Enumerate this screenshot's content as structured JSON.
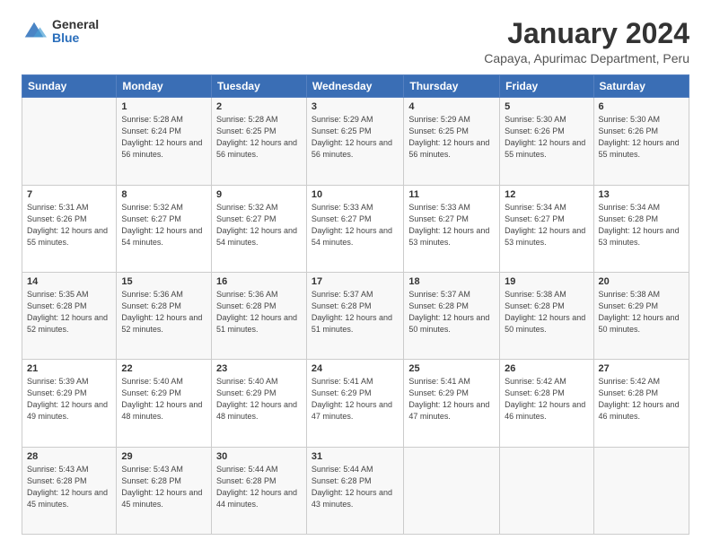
{
  "logo": {
    "general": "General",
    "blue": "Blue"
  },
  "header": {
    "title": "January 2024",
    "subtitle": "Capaya, Apurimac Department, Peru"
  },
  "weekdays": [
    "Sunday",
    "Monday",
    "Tuesday",
    "Wednesday",
    "Thursday",
    "Friday",
    "Saturday"
  ],
  "weeks": [
    [
      {
        "day": "",
        "sunrise": "",
        "sunset": "",
        "daylight": ""
      },
      {
        "day": "1",
        "sunrise": "Sunrise: 5:28 AM",
        "sunset": "Sunset: 6:24 PM",
        "daylight": "Daylight: 12 hours and 56 minutes."
      },
      {
        "day": "2",
        "sunrise": "Sunrise: 5:28 AM",
        "sunset": "Sunset: 6:25 PM",
        "daylight": "Daylight: 12 hours and 56 minutes."
      },
      {
        "day": "3",
        "sunrise": "Sunrise: 5:29 AM",
        "sunset": "Sunset: 6:25 PM",
        "daylight": "Daylight: 12 hours and 56 minutes."
      },
      {
        "day": "4",
        "sunrise": "Sunrise: 5:29 AM",
        "sunset": "Sunset: 6:25 PM",
        "daylight": "Daylight: 12 hours and 56 minutes."
      },
      {
        "day": "5",
        "sunrise": "Sunrise: 5:30 AM",
        "sunset": "Sunset: 6:26 PM",
        "daylight": "Daylight: 12 hours and 55 minutes."
      },
      {
        "day": "6",
        "sunrise": "Sunrise: 5:30 AM",
        "sunset": "Sunset: 6:26 PM",
        "daylight": "Daylight: 12 hours and 55 minutes."
      }
    ],
    [
      {
        "day": "7",
        "sunrise": "Sunrise: 5:31 AM",
        "sunset": "Sunset: 6:26 PM",
        "daylight": "Daylight: 12 hours and 55 minutes."
      },
      {
        "day": "8",
        "sunrise": "Sunrise: 5:32 AM",
        "sunset": "Sunset: 6:27 PM",
        "daylight": "Daylight: 12 hours and 54 minutes."
      },
      {
        "day": "9",
        "sunrise": "Sunrise: 5:32 AM",
        "sunset": "Sunset: 6:27 PM",
        "daylight": "Daylight: 12 hours and 54 minutes."
      },
      {
        "day": "10",
        "sunrise": "Sunrise: 5:33 AM",
        "sunset": "Sunset: 6:27 PM",
        "daylight": "Daylight: 12 hours and 54 minutes."
      },
      {
        "day": "11",
        "sunrise": "Sunrise: 5:33 AM",
        "sunset": "Sunset: 6:27 PM",
        "daylight": "Daylight: 12 hours and 53 minutes."
      },
      {
        "day": "12",
        "sunrise": "Sunrise: 5:34 AM",
        "sunset": "Sunset: 6:27 PM",
        "daylight": "Daylight: 12 hours and 53 minutes."
      },
      {
        "day": "13",
        "sunrise": "Sunrise: 5:34 AM",
        "sunset": "Sunset: 6:28 PM",
        "daylight": "Daylight: 12 hours and 53 minutes."
      }
    ],
    [
      {
        "day": "14",
        "sunrise": "Sunrise: 5:35 AM",
        "sunset": "Sunset: 6:28 PM",
        "daylight": "Daylight: 12 hours and 52 minutes."
      },
      {
        "day": "15",
        "sunrise": "Sunrise: 5:36 AM",
        "sunset": "Sunset: 6:28 PM",
        "daylight": "Daylight: 12 hours and 52 minutes."
      },
      {
        "day": "16",
        "sunrise": "Sunrise: 5:36 AM",
        "sunset": "Sunset: 6:28 PM",
        "daylight": "Daylight: 12 hours and 51 minutes."
      },
      {
        "day": "17",
        "sunrise": "Sunrise: 5:37 AM",
        "sunset": "Sunset: 6:28 PM",
        "daylight": "Daylight: 12 hours and 51 minutes."
      },
      {
        "day": "18",
        "sunrise": "Sunrise: 5:37 AM",
        "sunset": "Sunset: 6:28 PM",
        "daylight": "Daylight: 12 hours and 50 minutes."
      },
      {
        "day": "19",
        "sunrise": "Sunrise: 5:38 AM",
        "sunset": "Sunset: 6:28 PM",
        "daylight": "Daylight: 12 hours and 50 minutes."
      },
      {
        "day": "20",
        "sunrise": "Sunrise: 5:38 AM",
        "sunset": "Sunset: 6:29 PM",
        "daylight": "Daylight: 12 hours and 50 minutes."
      }
    ],
    [
      {
        "day": "21",
        "sunrise": "Sunrise: 5:39 AM",
        "sunset": "Sunset: 6:29 PM",
        "daylight": "Daylight: 12 hours and 49 minutes."
      },
      {
        "day": "22",
        "sunrise": "Sunrise: 5:40 AM",
        "sunset": "Sunset: 6:29 PM",
        "daylight": "Daylight: 12 hours and 48 minutes."
      },
      {
        "day": "23",
        "sunrise": "Sunrise: 5:40 AM",
        "sunset": "Sunset: 6:29 PM",
        "daylight": "Daylight: 12 hours and 48 minutes."
      },
      {
        "day": "24",
        "sunrise": "Sunrise: 5:41 AM",
        "sunset": "Sunset: 6:29 PM",
        "daylight": "Daylight: 12 hours and 47 minutes."
      },
      {
        "day": "25",
        "sunrise": "Sunrise: 5:41 AM",
        "sunset": "Sunset: 6:29 PM",
        "daylight": "Daylight: 12 hours and 47 minutes."
      },
      {
        "day": "26",
        "sunrise": "Sunrise: 5:42 AM",
        "sunset": "Sunset: 6:28 PM",
        "daylight": "Daylight: 12 hours and 46 minutes."
      },
      {
        "day": "27",
        "sunrise": "Sunrise: 5:42 AM",
        "sunset": "Sunset: 6:28 PM",
        "daylight": "Daylight: 12 hours and 46 minutes."
      }
    ],
    [
      {
        "day": "28",
        "sunrise": "Sunrise: 5:43 AM",
        "sunset": "Sunset: 6:28 PM",
        "daylight": "Daylight: 12 hours and 45 minutes."
      },
      {
        "day": "29",
        "sunrise": "Sunrise: 5:43 AM",
        "sunset": "Sunset: 6:28 PM",
        "daylight": "Daylight: 12 hours and 45 minutes."
      },
      {
        "day": "30",
        "sunrise": "Sunrise: 5:44 AM",
        "sunset": "Sunset: 6:28 PM",
        "daylight": "Daylight: 12 hours and 44 minutes."
      },
      {
        "day": "31",
        "sunrise": "Sunrise: 5:44 AM",
        "sunset": "Sunset: 6:28 PM",
        "daylight": "Daylight: 12 hours and 43 minutes."
      },
      {
        "day": "",
        "sunrise": "",
        "sunset": "",
        "daylight": ""
      },
      {
        "day": "",
        "sunrise": "",
        "sunset": "",
        "daylight": ""
      },
      {
        "day": "",
        "sunrise": "",
        "sunset": "",
        "daylight": ""
      }
    ]
  ]
}
